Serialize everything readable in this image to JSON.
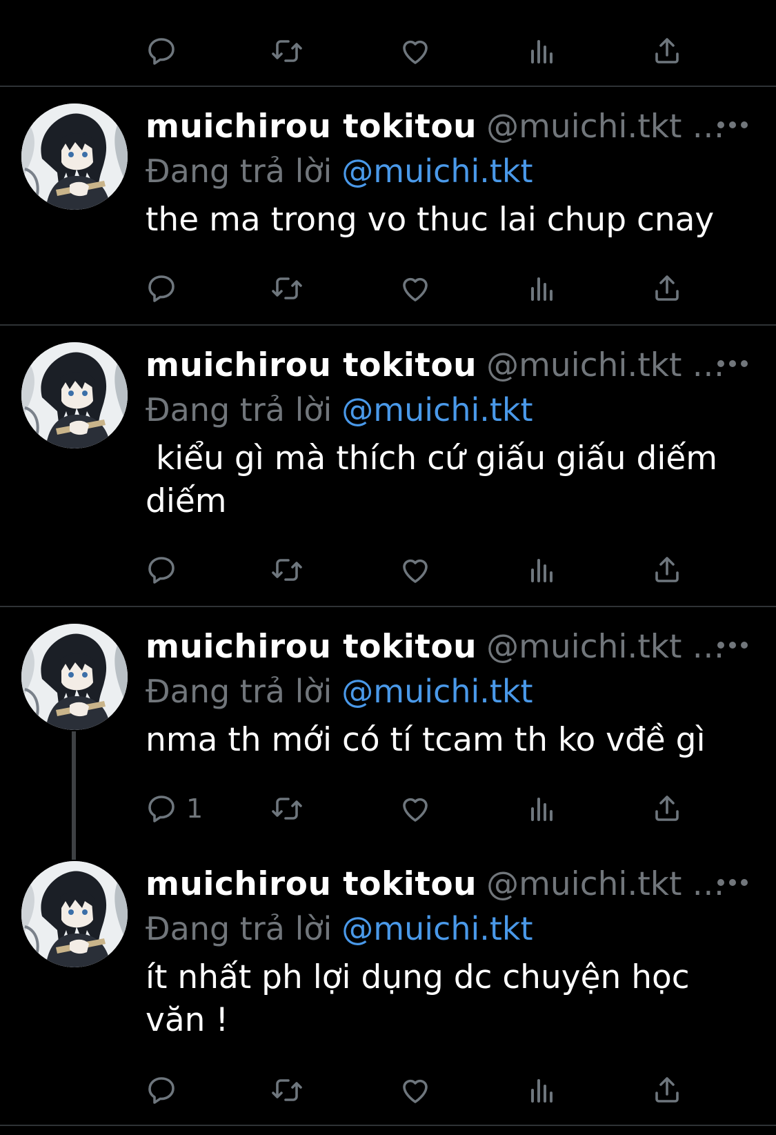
{
  "tweets": [
    {
      "name": "muichirou tokitou",
      "handle": "@muichi.tkt …",
      "replying_label": "Đang trả lời",
      "replying_to": "@muichi.tkt",
      "text": "the ma trong vo thuc lai chup cnay",
      "reply_count": ""
    },
    {
      "name": "muichirou tokitou",
      "handle": "@muichi.tkt …",
      "replying_label": "Đang trả lời",
      "replying_to": "@muichi.tkt",
      "text": " kiểu gì mà thích cứ giấu giấu diếm diếm",
      "reply_count": ""
    },
    {
      "name": "muichirou tokitou",
      "handle": "@muichi.tkt …",
      "replying_label": "Đang trả lời",
      "replying_to": "@muichi.tkt",
      "text": "nma th mới có tí tcam th ko vđề gì",
      "reply_count": "1"
    },
    {
      "name": "muichirou tokitou",
      "handle": "@muichi.tkt …",
      "replying_label": "Đang trả lời",
      "replying_to": "@muichi.tkt",
      "text": "ít nhất ph lợi dụng dc chuyện học văn !",
      "reply_count": ""
    }
  ],
  "icons": {
    "reply": "reply-icon",
    "retweet": "retweet-icon",
    "like": "heart-icon",
    "views": "views-icon",
    "share": "share-icon",
    "more": "more-icon"
  },
  "colors": {
    "background": "#000000",
    "name": "#ffffff",
    "handle": "#71767b",
    "mention": "#4a99e9",
    "divider": "#2f3336"
  }
}
